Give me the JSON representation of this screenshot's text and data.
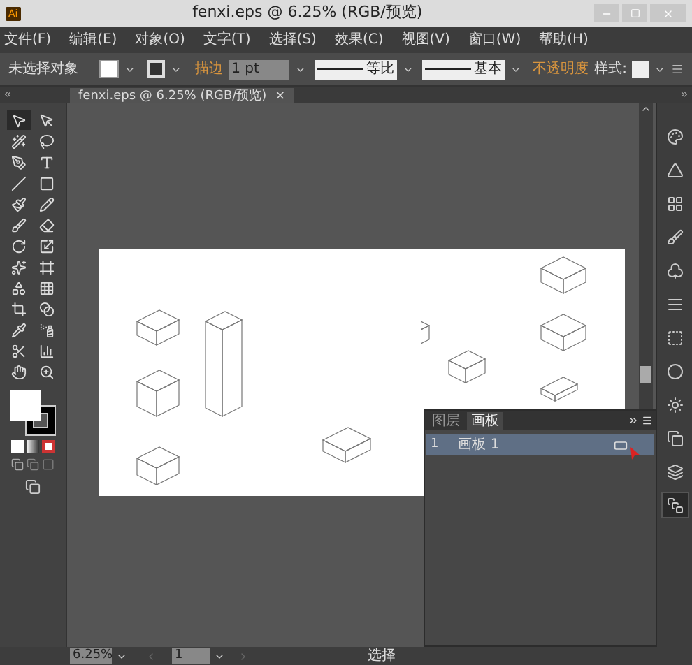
{
  "title_bar": {
    "app_badge": "Ai",
    "title": "fenxi.eps @ 6.25% (RGB/预览)"
  },
  "menu": [
    "文件(F)",
    "编辑(E)",
    "对象(O)",
    "文字(T)",
    "选择(S)",
    "效果(C)",
    "视图(V)",
    "窗口(W)",
    "帮助(H)"
  ],
  "control_bar": {
    "selection": "未选择对象",
    "stroke_label": "描边",
    "stroke_weight": "1 pt",
    "profile": "等比",
    "brush": "基本",
    "opacity_label": "不透明度",
    "style_label": "样式:"
  },
  "document_tab": {
    "title": "fenxi.eps @ 6.25% (RGB/预览)",
    "close": "×"
  },
  "tools": [
    {
      "selected": true
    },
    {
      "selected": false
    },
    {
      "selected": false
    },
    {
      "selected": false
    },
    {
      "selected": false
    },
    {
      "selected": false
    },
    {
      "selected": false
    },
    {
      "selected": false
    },
    {
      "selected": false
    },
    {
      "selected": false
    },
    {
      "selected": false
    },
    {
      "selected": false
    },
    {
      "selected": false
    },
    {
      "selected": false
    },
    {
      "selected": false
    },
    {
      "selected": false
    },
    {
      "selected": false
    },
    {
      "selected": false
    },
    {
      "selected": false
    },
    {
      "selected": false
    },
    {
      "selected": false
    },
    {
      "selected": false
    },
    {
      "selected": false
    },
    {
      "selected": false
    },
    {
      "selected": false
    },
    {
      "selected": false
    }
  ],
  "dock": [
    {
      "selected": false
    },
    {
      "selected": false
    },
    {
      "selected": false
    },
    {
      "selected": false
    },
    {
      "selected": false
    },
    {
      "selected": false
    },
    {
      "selected": false
    },
    {
      "selected": false
    },
    {
      "selected": false
    },
    {
      "selected": false
    },
    {
      "selected": false
    },
    {
      "selected": true
    }
  ],
  "panel": {
    "tabs": [
      {
        "label": "图层",
        "selected": false
      },
      {
        "label": "画板",
        "selected": true
      }
    ],
    "rows": [
      {
        "number": "1",
        "name": "画板 1",
        "selected": true
      }
    ]
  },
  "status_bar": {
    "zoom": "6.25%",
    "page": "1",
    "tool": "选择"
  }
}
